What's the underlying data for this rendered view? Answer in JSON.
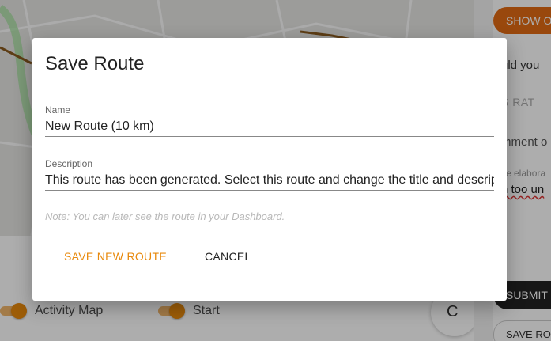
{
  "dialog": {
    "title": "Save Route",
    "name_label": "Name",
    "name_value": "New Route (10 km)",
    "description_label": "Description",
    "description_value": "This route has been generated. Select this route and change the title and description",
    "note": "Note: You can later see the route in your Dashboard.",
    "save_button": "SAVE NEW ROUTE",
    "cancel_button": "CANCEL"
  },
  "background": {
    "toggles": [
      {
        "label": "Activity Map",
        "on": true
      },
      {
        "label": "Start",
        "on": true
      }
    ],
    "round_button_glyph": "C"
  },
  "right_panel": {
    "show_button": "SHOW O",
    "question_fragment": "uld you",
    "tabs_fragment": "S   RAT",
    "comment_fragment": "mment o",
    "elaborate_fragment": "se elabora",
    "value_fragment": "n too un",
    "submit_button": "SUBMIT",
    "save_route_button": "SAVE RO"
  },
  "colors": {
    "accent": "#e8890c",
    "show_button": "#e26a14",
    "overlay": "rgba(0,0,0,0.32)"
  }
}
